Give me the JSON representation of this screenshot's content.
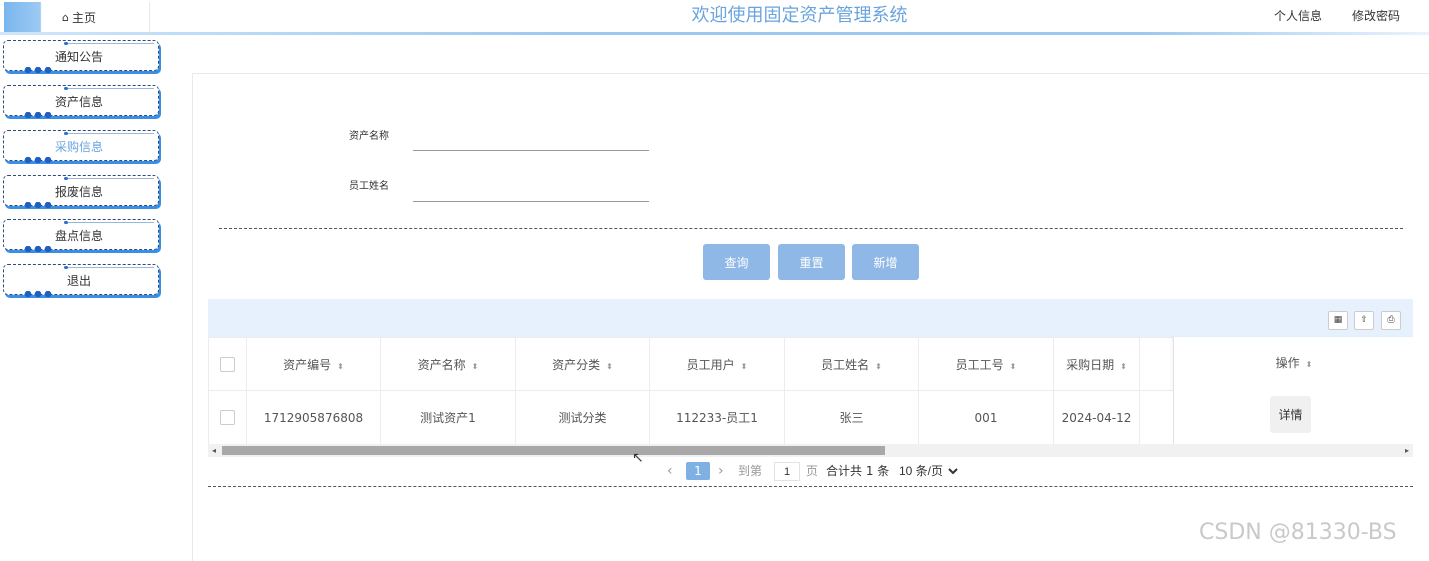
{
  "header": {
    "home_icon": "⌂",
    "home_label": "主页",
    "title": "欢迎使用固定资产管理系统",
    "profile_link": "个人信息",
    "password_link": "修改密码"
  },
  "sidebar": {
    "items": [
      {
        "label": "通知公告"
      },
      {
        "label": "资产信息"
      },
      {
        "label": "采购信息",
        "active": true
      },
      {
        "label": "报废信息"
      },
      {
        "label": "盘点信息"
      },
      {
        "label": "退出"
      }
    ]
  },
  "search": {
    "asset_name_label": "资产名称",
    "asset_name_value": "",
    "employee_name_label": "员工姓名",
    "employee_name_value": ""
  },
  "actions": {
    "query": "查询",
    "reset": "重置",
    "add": "新增"
  },
  "toolbar": {
    "columns_icon": "columns-icon",
    "export_icon": "export-icon",
    "print_icon": "print-icon"
  },
  "table": {
    "columns": [
      "资产编号",
      "资产名称",
      "资产分类",
      "员工用户",
      "员工姓名",
      "员工工号",
      "采购日期",
      "操作"
    ],
    "rows": [
      {
        "asset_no": "1712905876808",
        "asset_name": "测试资产1",
        "category": "测试分类",
        "employee_user": "112233-员工1",
        "employee_name": "张三",
        "employee_no": "001",
        "purchase_date": "2024-04-12",
        "action": "详情"
      }
    ]
  },
  "pagination": {
    "prev": "‹",
    "current": "1",
    "next": "›",
    "goto_prefix": "到第",
    "goto_value": "1",
    "goto_suffix": "页",
    "total": "合计共 1 条",
    "page_size": "10 条/页"
  },
  "watermark": "CSDN @81330-BS",
  "theme": {
    "accent": "#6aa4de",
    "button": "#8fb8e6",
    "toolbar_bg": "#e6f1fd"
  }
}
